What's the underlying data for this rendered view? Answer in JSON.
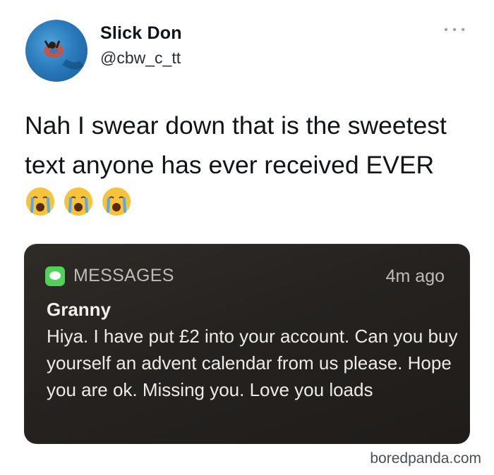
{
  "tweet": {
    "display_name": "Slick Don",
    "handle": "@cbw_c_tt",
    "more_icon": "ellipsis-icon",
    "text": "Nah I swear down that is the sweetest text anyone has ever received EVER",
    "emojis": [
      "crying-face-emoji",
      "crying-face-emoji",
      "crying-face-emoji"
    ]
  },
  "notification": {
    "app_icon": "messages-icon",
    "app_name": "MESSAGES",
    "time": "4m ago",
    "sender": "Granny",
    "message": "Hiya. I have put £2 into your account. Can you buy yourself an advent calendar from us please. Hope you are ok. Missing you. Love you loads"
  },
  "watermark": "boredpanda.com",
  "colors": {
    "notification_bg": "#252220",
    "messages_green": "#4fd15a",
    "emoji_yellow": "#f6c33a",
    "tear_blue": "#5aa9e6"
  }
}
